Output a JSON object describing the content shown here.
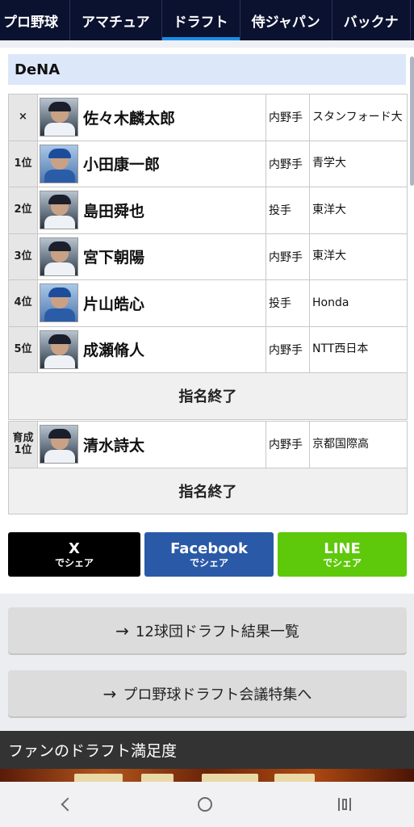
{
  "tabs": [
    {
      "label": "プロ野球",
      "active": false
    },
    {
      "label": "アマチュア",
      "active": false
    },
    {
      "label": "ドラフト",
      "active": true
    },
    {
      "label": "侍ジャパン",
      "active": false
    },
    {
      "label": "バックナ",
      "active": false
    }
  ],
  "team": {
    "name": "DeNA"
  },
  "picks": [
    {
      "rank": "×",
      "name": "佐々木麟太郎",
      "position": "内野手",
      "school": "スタンフォード大"
    },
    {
      "rank": "1位",
      "name": "小田康一郎",
      "position": "内野手",
      "school": "青学大"
    },
    {
      "rank": "2位",
      "name": "島田舜也",
      "position": "投手",
      "school": "東洋大"
    },
    {
      "rank": "3位",
      "name": "宮下朝陽",
      "position": "内野手",
      "school": "東洋大"
    },
    {
      "rank": "4位",
      "name": "片山皓心",
      "position": "投手",
      "school": "Honda"
    },
    {
      "rank": "5位",
      "name": "成瀬脩人",
      "position": "内野手",
      "school": "NTT西日本"
    }
  ],
  "end_label": "指名終了",
  "ikusei": [
    {
      "rank_line1": "育成",
      "rank_line2": "1位",
      "name": "清水詩太",
      "position": "内野手",
      "school": "京都国際高"
    }
  ],
  "ikusei_end_label": "指名終了",
  "share": {
    "x_label": "X",
    "x_sub": "でシェア",
    "fb_label": "Facebook",
    "fb_sub": "でシェア",
    "line_label": "LINE",
    "line_sub": "でシェア"
  },
  "links": {
    "results_label": "12球団ドラフト結果一覧",
    "special_label": "プロ野球ドラフト会議特集へ"
  },
  "fan_section": {
    "title": "ファンのドラフト満足度"
  },
  "colors": {
    "tabbar": "#0b1230",
    "tab_active": "#1a8ee8",
    "x": "#000000",
    "facebook": "#2a5aa7",
    "line": "#5ec80a"
  }
}
